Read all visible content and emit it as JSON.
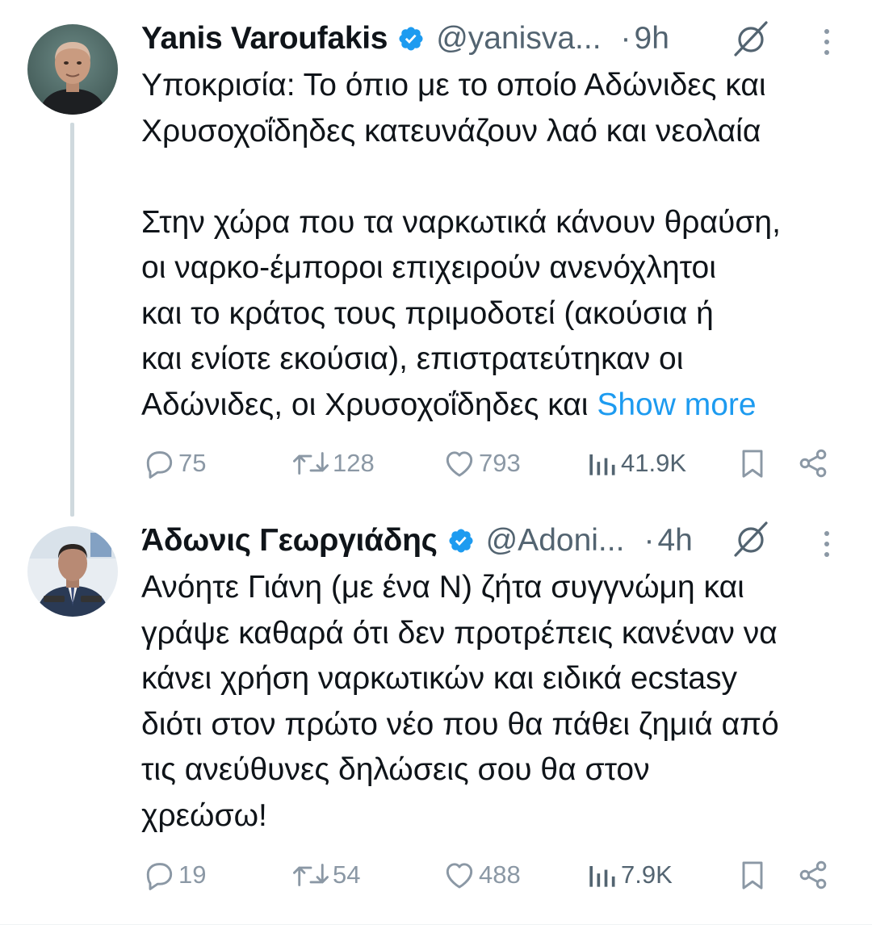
{
  "tweets": [
    {
      "author": {
        "name": "Yanis Varoufakis",
        "handle": "@yanisva...",
        "verified": true,
        "avatar_description": "portrait photo"
      },
      "separator": "·",
      "time": "9h",
      "text_lines": [
        "Υποκρισία: Το όπιο με το οποίο Αδώνιδες και",
        "Χρυσοχοΐδηδες κατευνάζουν λαό και νεολαία",
        "",
        "Στην χώρα που τα ναρκωτικά κάνουν θραύση,",
        "οι ναρκο-έμποροι επιχειρούν ανενόχλητοι",
        "και το κράτος τους πριμοδοτεί (ακούσια ή",
        "και ενίοτε εκούσια), επιστρατεύτηκαν οι",
        "Αδώνιδες, οι Χρυσοχοΐδηδες και "
      ],
      "show_more": "Show more",
      "stats": {
        "replies": "75",
        "retweets": "128",
        "likes": "793",
        "views": "41.9K"
      }
    },
    {
      "author": {
        "name": "Άδωνις Γεωργιάδης",
        "handle": "@Adoni...",
        "verified": true,
        "avatar_description": "man in suit at podium"
      },
      "separator": "·",
      "time": "4h",
      "text_lines": [
        "Ανόητε Γιάνη (με ένα Ν) ζήτα συγγνώμη και",
        "γράψε καθαρά ότι δεν προτρέπεις κανέναν να",
        "κάνει χρήση ναρκωτικών και ειδικά ecstasy",
        "διότι στον πρώτο νέο που θα πάθει ζημιά από",
        "τις ανεύθυνες δηλώσεις σου θα στον",
        "χρεώσω!"
      ],
      "stats": {
        "replies": "19",
        "retweets": "54",
        "likes": "488",
        "views": "7.9K"
      }
    }
  ],
  "icons": {
    "verified": "verified-badge-icon",
    "mute": "noise-slash-icon",
    "more": "more-vertical-icon",
    "reply": "reply-bubble-icon",
    "retweet": "retweet-icon",
    "like": "heart-icon",
    "views": "bar-chart-icon",
    "bookmark": "bookmark-icon",
    "share": "share-icon"
  },
  "colors": {
    "text": "#0f1419",
    "secondary": "#536471",
    "action": "#8b98a5",
    "link": "#1d9bf0",
    "verified": "#1d9bf0",
    "thread_line": "#cfd9de"
  }
}
